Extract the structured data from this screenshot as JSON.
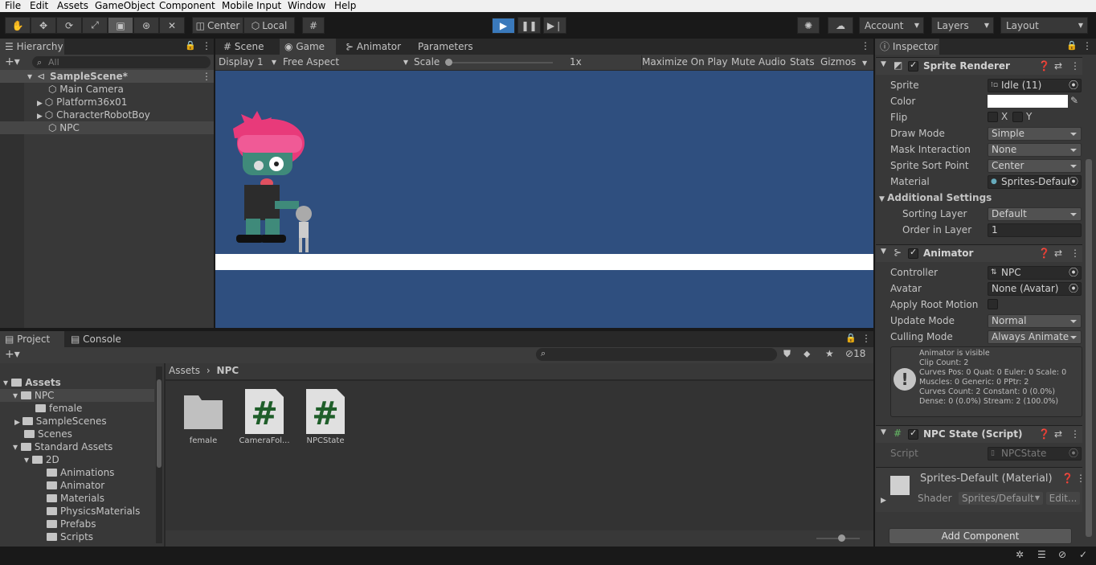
{
  "menu": [
    "File",
    "Edit",
    "Assets",
    "GameObject",
    "Component",
    "Mobile Input",
    "Window",
    "Help"
  ],
  "toolbar": {
    "center": "Center",
    "local": "Local",
    "account": "Account",
    "layers": "Layers",
    "layout": "Layout"
  },
  "hierarchy": {
    "tab": "Hierarchy",
    "search_placeholder": "All",
    "scene": "SampleScene*",
    "items": [
      "Main Camera",
      "Platform36x01",
      "CharacterRobotBoy",
      "NPC"
    ]
  },
  "game": {
    "tabs": [
      "Scene",
      "Game",
      "Animator",
      "Parameters"
    ],
    "display": "Display 1",
    "aspect": "Free Aspect",
    "scale_label": "Scale",
    "scale_value": "1x",
    "maximize": "Maximize On Play",
    "mute": "Mute Audio",
    "stats": "Stats",
    "gizmos": "Gizmos"
  },
  "project": {
    "tabs": [
      "Project",
      "Console"
    ],
    "hidden_count": "18",
    "tree": [
      "Assets",
      "NPC",
      "female",
      "SampleScenes",
      "Scenes",
      "Standard Assets",
      "2D",
      "Animations",
      "Animator",
      "Materials",
      "PhysicsMaterials",
      "Prefabs",
      "Scripts"
    ],
    "breadcrumb": [
      "Assets",
      "NPC"
    ],
    "assets": [
      "female",
      "CameraFol...",
      "NPCState"
    ]
  },
  "inspector": {
    "tab": "Inspector",
    "sprite_renderer": {
      "title": "Sprite Renderer",
      "sprite_label": "Sprite",
      "sprite": "Idle (11)",
      "color_label": "Color",
      "flip_label": "Flip",
      "flip_x": "X",
      "flip_y": "Y",
      "draw_mode_label": "Draw Mode",
      "draw_mode": "Simple",
      "mask_label": "Mask Interaction",
      "mask": "None",
      "sort_point_label": "Sprite Sort Point",
      "sort_point": "Center",
      "material_label": "Material",
      "material": "Sprites-Defaul",
      "additional": "Additional Settings",
      "sorting_layer_label": "Sorting Layer",
      "sorting_layer": "Default",
      "order_label": "Order in Layer",
      "order": "1"
    },
    "animator": {
      "title": "Animator",
      "controller_label": "Controller",
      "controller": "NPC",
      "avatar_label": "Avatar",
      "avatar": "None (Avatar)",
      "root_motion_label": "Apply Root Motion",
      "update_label": "Update Mode",
      "update": "Normal",
      "culling_label": "Culling Mode",
      "culling": "Always Animate",
      "info": [
        "Animator is visible",
        "Clip Count: 2",
        "Curves Pos: 0 Quat: 0 Euler: 0 Scale: 0",
        "Muscles: 0 Generic: 0 PPtr: 2",
        "Curves Count: 2 Constant: 0 (0.0%)",
        "Dense: 0 (0.0%) Stream: 2 (100.0%)"
      ]
    },
    "script": {
      "title": "NPC State (Script)",
      "label": "Script",
      "value": "NPCState"
    },
    "material": {
      "title": "Sprites-Default (Material)",
      "shader_label": "Shader",
      "shader": "Sprites/Default",
      "edit": "Edit..."
    },
    "add_component": "Add Component"
  },
  "colors": {
    "game_bg": "#2f4f7f",
    "accent": "#3a79bb"
  }
}
